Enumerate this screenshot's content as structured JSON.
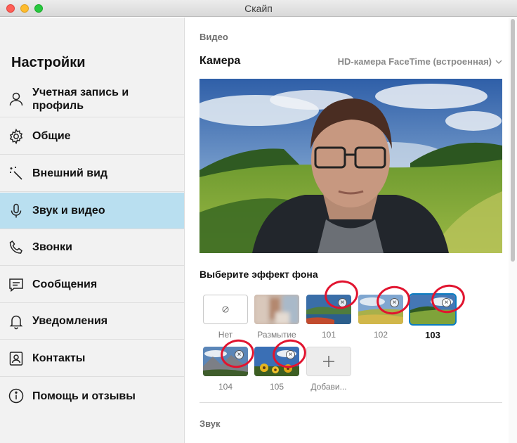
{
  "window": {
    "title": "Скайп"
  },
  "sidebar": {
    "title": "Настройки",
    "items": [
      {
        "label": "Учетная запись и профиль",
        "icon": "person-icon"
      },
      {
        "label": "Общие",
        "icon": "gear-icon"
      },
      {
        "label": "Внешний вид",
        "icon": "magic-wand-icon"
      },
      {
        "label": "Звук и видео",
        "icon": "microphone-icon",
        "active": true
      },
      {
        "label": "Звонки",
        "icon": "phone-icon"
      },
      {
        "label": "Сообщения",
        "icon": "message-icon"
      },
      {
        "label": "Уведомления",
        "icon": "bell-icon"
      },
      {
        "label": "Контакты",
        "icon": "contacts-icon"
      },
      {
        "label": "Помощь и отзывы",
        "icon": "info-icon"
      }
    ]
  },
  "main": {
    "video_section": "Видео",
    "camera_label": "Камера",
    "camera_device": "HD-камера FaceTime (встроенная)",
    "effect_title": "Выберите эффект фона",
    "effects": [
      {
        "label": "Нет",
        "type": "none"
      },
      {
        "label": "Размытие",
        "type": "blur"
      },
      {
        "label": "101",
        "type": "image",
        "removable": true
      },
      {
        "label": "102",
        "type": "image",
        "removable": true
      },
      {
        "label": "103",
        "type": "image",
        "removable": true,
        "selected": true
      },
      {
        "label": "104",
        "type": "image",
        "removable": true
      },
      {
        "label": "105",
        "type": "image",
        "removable": true
      },
      {
        "label": "Добави...",
        "type": "add"
      }
    ],
    "audio_section": "Звук"
  },
  "colors": {
    "active_item": "#b9dff0",
    "selected_border": "#0a7cc1",
    "annotation": "#e1142f"
  }
}
